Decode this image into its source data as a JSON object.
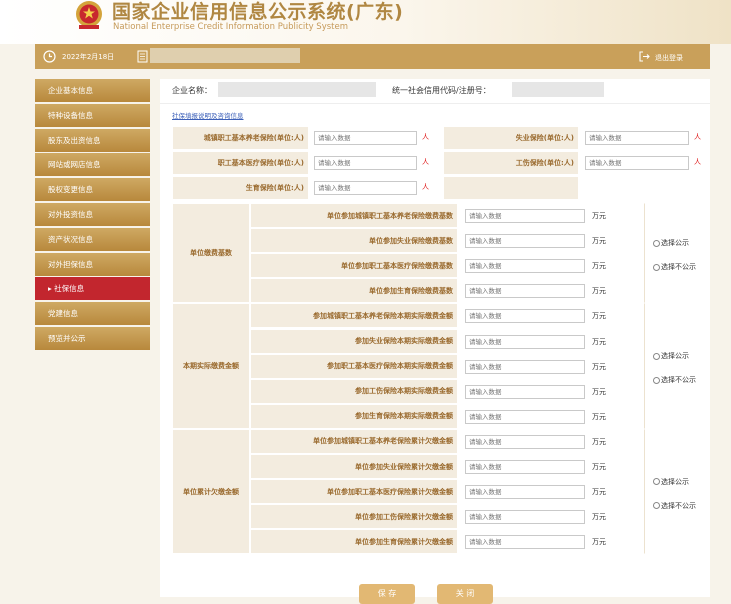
{
  "header": {
    "title_cn": "国家企业信用信息公示系统(广东)",
    "title_en": "National Enterprise Credit Information Publicity System"
  },
  "infobar": {
    "date": "2022年2月18日",
    "logout": "退出登录"
  },
  "sidebar": {
    "items": [
      {
        "label": "企业基本信息",
        "active": false
      },
      {
        "label": "特种设备信息",
        "active": false
      },
      {
        "label": "股东及出资信息",
        "active": false
      },
      {
        "label": "网站或网店信息",
        "active": false
      },
      {
        "label": "股权变更信息",
        "active": false
      },
      {
        "label": "对外投资信息",
        "active": false
      },
      {
        "label": "资产状况信息",
        "active": false
      },
      {
        "label": "对外担保信息",
        "active": false
      },
      {
        "label": "▸ 社保信息",
        "active": true
      },
      {
        "label": "党建信息",
        "active": false
      },
      {
        "label": "预览并公示",
        "active": false
      }
    ]
  },
  "company": {
    "name_label": "企业名称：",
    "code_label": "统一社会信用代码/注册号："
  },
  "link": "社保填报说明及咨询信息",
  "insured": {
    "placeholder": "请输入数据",
    "unit": "人",
    "fields": [
      {
        "label": "城镇职工基本养老保险(单位:人)"
      },
      {
        "label": "失业保险(单位:人)"
      },
      {
        "label": "职工基本医疗保险(单位:人)"
      },
      {
        "label": "工伤保险(单位:人)"
      },
      {
        "label": "生育保险(单位:人)"
      }
    ]
  },
  "money": {
    "placeholder": "请输入数据",
    "unit": "万元",
    "radio_public": "选择公示",
    "radio_private": "选择不公示",
    "groups": [
      {
        "title": "单位缴费基数",
        "rows": [
          "单位参加城镇职工基本养老保险缴费基数",
          "单位参加失业保险缴费基数",
          "单位参加职工基本医疗保险缴费基数",
          "单位参加生育保险缴费基数"
        ]
      },
      {
        "title": "本期实际缴费金额",
        "rows": [
          "参加城镇职工基本养老保险本期实际缴费金额",
          "参加失业保险本期实际缴费金额",
          "参加职工基本医疗保险本期实际缴费金额",
          "参加工伤保险本期实际缴费金额",
          "参加生育保险本期实际缴费金额"
        ]
      },
      {
        "title": "单位累计欠缴金额",
        "rows": [
          "单位参加城镇职工基本养老保险累计欠缴金额",
          "单位参加失业保险累计欠缴金额",
          "单位参加职工基本医疗保险累计欠缴金额",
          "单位参加工伤保险累计欠缴金额",
          "单位参加生育保险累计欠缴金额"
        ]
      }
    ]
  },
  "buttons": {
    "save": "保 存",
    "close": "关 闭"
  }
}
